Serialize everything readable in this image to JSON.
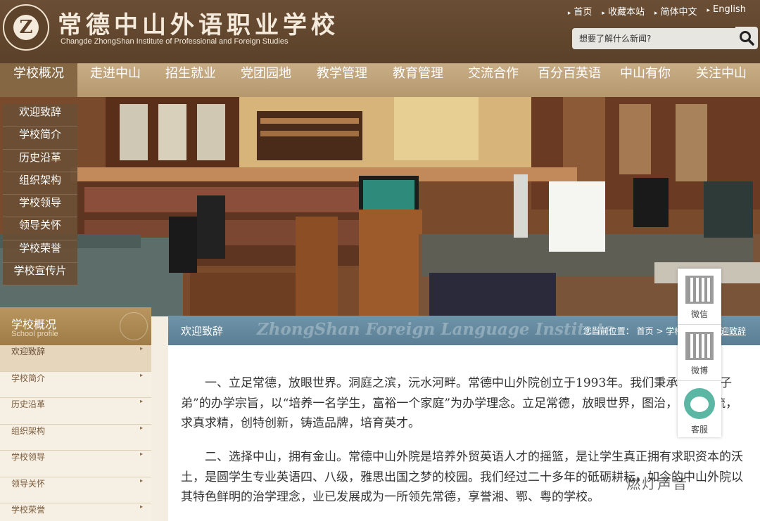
{
  "header": {
    "title": "常德中山外语职业学校",
    "subtitle": "Changde ZhongShan Institute of Professional and Foreign Studies",
    "toplinks": [
      "首页",
      "收藏本站",
      "简体中文",
      "English"
    ],
    "search_placeholder": "想要了解什么新闻?"
  },
  "nav": {
    "items": [
      "学校概况",
      "走进中山",
      "招生就业",
      "党团园地",
      "教学管理",
      "教育管理",
      "交流合作",
      "百分百英语",
      "中山有你",
      "关注中山"
    ]
  },
  "dropdown": {
    "items": [
      "欢迎致辞",
      "学校简介",
      "历史沿革",
      "组织架构",
      "学校领导",
      "领导关怀",
      "学校荣誉",
      "学校宣传片"
    ]
  },
  "sidebar": {
    "title": "学校概况",
    "subtitle": "School profile",
    "items": [
      "欢迎致辞",
      "学校简介",
      "历史沿革",
      "组织架构",
      "学校领导",
      "领导关怀",
      "学校荣誉"
    ]
  },
  "content": {
    "title": "欢迎致辞",
    "watermark": "ZhongShan Foreign Language Institute",
    "breadcrumb_prefix": "您当前位置：",
    "breadcrumb": [
      "首页",
      "学校概况",
      "欢迎致辞"
    ],
    "paragraphs": [
      "一、立足常德，放眼世界。洞庭之滨，沅水河畔。常德中山外院创立于1993年。我们秉承“不误人子弟”的办学宗旨，以“培养一名学生，富裕一个家庭”为办学理念。立足常德，放眼世界，图治，引领潮流，求真求精，创特创新，铸造品牌，培育英才。",
      "二、选择中山，拥有金山。常德中山外院是培养外贸英语人才的摇篮，是让学生真正拥有求职资本的沃土，是圆学生专业英语四、八级，雅思出国之梦的校园。我们经过二十多年的砥砺耕耘，如今的中山外院以其特色鲜明的治学理念，业已发展成为一所领先常德，享誉湘、鄂、粤的学校。"
    ]
  },
  "float_panel": {
    "items": [
      "微信",
      "微博",
      "客服"
    ]
  },
  "overlay_watermark": "燃灯声音"
}
